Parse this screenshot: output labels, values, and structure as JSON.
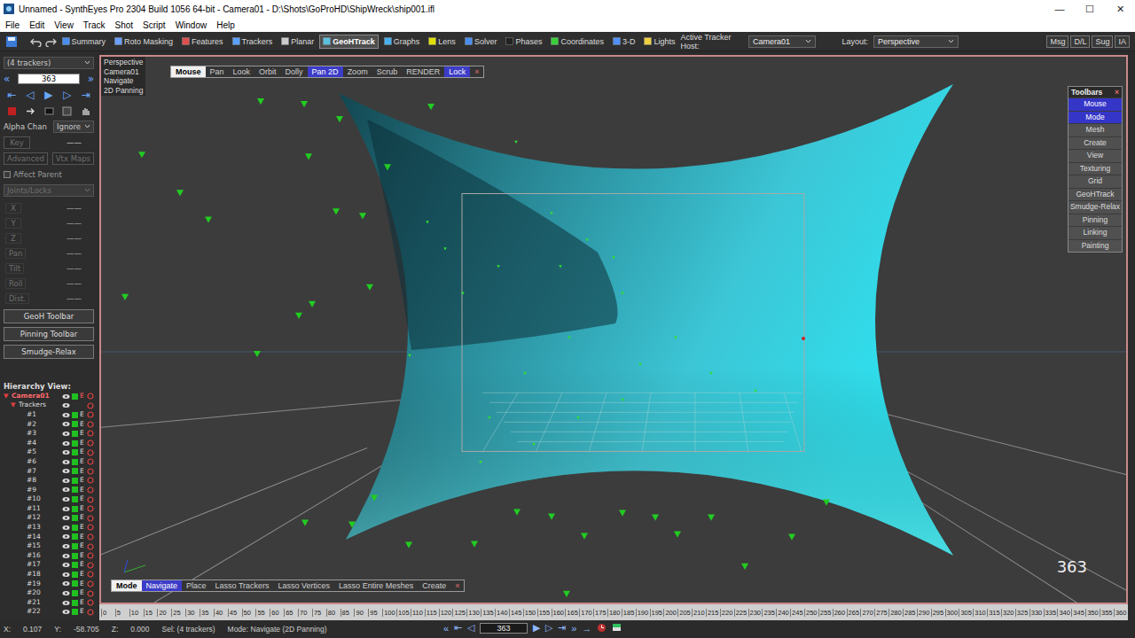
{
  "window": {
    "title": "Unnamed - SynthEyes Pro 2304 Build 1056 64-bit - Camera01 - D:\\Shots\\GoProHD\\ShipWreck\\ship001.ifl",
    "controls": [
      "—",
      "☐",
      "✕"
    ]
  },
  "menu": [
    "File",
    "Edit",
    "View",
    "Track",
    "Shot",
    "Script",
    "Window",
    "Help"
  ],
  "toolbar": {
    "tabs": [
      {
        "label": "Summary",
        "selected": false
      },
      {
        "label": "Roto Masking",
        "selected": false
      },
      {
        "label": "Features",
        "selected": false
      },
      {
        "label": "Trackers",
        "selected": false
      },
      {
        "label": "Planar",
        "selected": false
      },
      {
        "label": "GeoHTrack",
        "selected": true
      },
      {
        "label": "Graphs",
        "selected": false
      },
      {
        "label": "Lens",
        "selected": false
      },
      {
        "label": "Solver",
        "selected": false
      },
      {
        "label": "Phases",
        "selected": false
      },
      {
        "label": "Coordinates",
        "selected": false
      },
      {
        "label": "3-D",
        "selected": false
      },
      {
        "label": "Lights",
        "selected": false
      }
    ],
    "host_label": "Active Tracker Host:",
    "host_value": "Camera01",
    "layout_label": "Layout:",
    "layout_value": "Perspective",
    "buttons": [
      "Msg",
      "D/L",
      "Sug",
      "IA"
    ]
  },
  "left_panel": {
    "selection": "(4 trackers)",
    "nav": [
      "«",
      "»"
    ],
    "frame": "363",
    "transport": [
      "⇤",
      "◁",
      "▶",
      "▷",
      "⇥"
    ],
    "alpha_label": "Alpha Chan",
    "alpha_value": "Ignore",
    "key": {
      "label": "Key",
      "value": "——",
      "disabled": true
    },
    "advanced": {
      "label": "Advanced",
      "disabled": true
    },
    "vtx_maps": {
      "label": "Vtx Maps",
      "disabled": true
    },
    "affect_parent": {
      "label": "Affect Parent",
      "checked": false
    },
    "joints": {
      "label": "Joints/Locks",
      "disabled": true
    },
    "fields": [
      {
        "label": "X",
        "value": "——"
      },
      {
        "label": "Y",
        "value": "——"
      },
      {
        "label": "Z",
        "value": "——"
      },
      {
        "label": "Pan",
        "value": "——"
      },
      {
        "label": "Tilt",
        "value": "——"
      },
      {
        "label": "Roll",
        "value": "——"
      },
      {
        "label": "Dist.",
        "value": "——"
      }
    ],
    "buttons": [
      "GeoH Toolbar",
      "Pinning Toolbar",
      "Smudge-Relax"
    ]
  },
  "hierarchy": {
    "title": "Hierarchy View:",
    "rows": [
      {
        "label": "Camera01",
        "kind": "camera",
        "toggle": "▼",
        "flag": "E"
      },
      {
        "label": "Trackers",
        "kind": "group",
        "toggle": "▼",
        "flag": ""
      },
      {
        "label": "#1",
        "kind": "tracker",
        "toggle": "",
        "flag": "E"
      },
      {
        "label": "#2",
        "kind": "tracker",
        "toggle": "",
        "flag": "E"
      },
      {
        "label": "#3",
        "kind": "tracker",
        "toggle": "",
        "flag": "E"
      },
      {
        "label": "#4",
        "kind": "tracker",
        "toggle": "",
        "flag": "E"
      },
      {
        "label": "#5",
        "kind": "tracker",
        "toggle": "",
        "flag": "E"
      },
      {
        "label": "#6",
        "kind": "tracker",
        "toggle": "",
        "flag": "E"
      },
      {
        "label": "#7",
        "kind": "tracker",
        "toggle": "",
        "flag": "E"
      },
      {
        "label": "#8",
        "kind": "tracker",
        "toggle": "",
        "flag": "E"
      },
      {
        "label": "#9",
        "kind": "tracker",
        "toggle": "",
        "flag": "E"
      },
      {
        "label": "#10",
        "kind": "tracker",
        "toggle": "",
        "flag": "E"
      },
      {
        "label": "#11",
        "kind": "tracker",
        "toggle": "",
        "flag": "E"
      },
      {
        "label": "#12",
        "kind": "tracker",
        "toggle": "",
        "flag": "E"
      },
      {
        "label": "#13",
        "kind": "tracker",
        "toggle": "",
        "flag": "E"
      },
      {
        "label": "#14",
        "kind": "tracker",
        "toggle": "",
        "flag": "E"
      },
      {
        "label": "#15",
        "kind": "tracker",
        "toggle": "",
        "flag": "E"
      },
      {
        "label": "#16",
        "kind": "tracker",
        "toggle": "",
        "flag": "E"
      },
      {
        "label": "#17",
        "kind": "tracker",
        "toggle": "",
        "flag": "E"
      },
      {
        "label": "#18",
        "kind": "tracker",
        "toggle": "",
        "flag": "E"
      },
      {
        "label": "#19",
        "kind": "tracker",
        "toggle": "",
        "flag": "E"
      },
      {
        "label": "#20",
        "kind": "tracker",
        "toggle": "",
        "flag": "E"
      },
      {
        "label": "#21",
        "kind": "tracker",
        "toggle": "",
        "flag": "E"
      },
      {
        "label": "#22",
        "kind": "tracker",
        "toggle": "",
        "flag": "E"
      }
    ]
  },
  "viewport": {
    "info": [
      "Perspective",
      "Camera01",
      "Navigate",
      "2D Panning"
    ],
    "mouse_header": "Mouse",
    "mouse_modes": [
      {
        "label": "Pan",
        "selected": false
      },
      {
        "label": "Look",
        "selected": false
      },
      {
        "label": "Orbit",
        "selected": false
      },
      {
        "label": "Dolly",
        "selected": false
      },
      {
        "label": "Pan 2D",
        "selected": true
      },
      {
        "label": "Zoom",
        "selected": false
      },
      {
        "label": "Scrub",
        "selected": false
      },
      {
        "label": "RENDER",
        "selected": false
      },
      {
        "label": "Lock",
        "selected": true
      }
    ],
    "mouse_close": "×",
    "mode_header": "Mode",
    "modes": [
      {
        "label": "Navigate",
        "selected": true
      },
      {
        "label": "Place",
        "selected": false
      },
      {
        "label": "Lasso Trackers",
        "selected": false
      },
      {
        "label": "Lasso Vertices",
        "selected": false
      },
      {
        "label": "Lasso Entire Meshes",
        "selected": false
      },
      {
        "label": "Create",
        "selected": false
      }
    ],
    "modes_close": "×",
    "frame": "363"
  },
  "toolbars_panel": {
    "title": "Toolbars",
    "close": "×",
    "items": [
      {
        "label": "Mouse",
        "selected": true
      },
      {
        "label": "Mode",
        "selected": true
      },
      {
        "label": "Mesh",
        "selected": false
      },
      {
        "label": "Create",
        "selected": false
      },
      {
        "label": "View",
        "selected": false
      },
      {
        "label": "Texturing",
        "selected": false
      },
      {
        "label": "Grid",
        "selected": false
      },
      {
        "label": "GeoHTrack",
        "selected": false
      },
      {
        "label": "Smudge-Relax",
        "selected": false
      },
      {
        "label": "Pinning",
        "selected": false
      },
      {
        "label": "Linking",
        "selected": false
      },
      {
        "label": "Painting",
        "selected": false
      }
    ]
  },
  "timeline": {
    "ticks": [
      "0",
      "5",
      "10",
      "15",
      "20",
      "25",
      "30",
      "35",
      "40",
      "45",
      "50",
      "55",
      "60",
      "65",
      "70",
      "75",
      "80",
      "85",
      "90",
      "95",
      "100",
      "105",
      "110",
      "115",
      "120",
      "125",
      "130",
      "135",
      "140",
      "145",
      "150",
      "155",
      "160",
      "165",
      "170",
      "175",
      "180",
      "185",
      "190",
      "195",
      "200",
      "205",
      "210",
      "215",
      "220",
      "225",
      "230",
      "235",
      "240",
      "245",
      "250",
      "255",
      "260",
      "265",
      "270",
      "275",
      "280",
      "285",
      "290",
      "295",
      "300",
      "305",
      "310",
      "315",
      "320",
      "325",
      "330",
      "335",
      "340",
      "345",
      "350",
      "355",
      "360"
    ]
  },
  "status_bar": {
    "x": "X:",
    "x_value": "0.107",
    "y": "Y:",
    "y_value": "-58.705",
    "z": "Z:",
    "z_value": "0.000",
    "selection": "Sel: (4 trackers)",
    "mode": "Mode: Navigate (2D Panning)",
    "transport": [
      "«",
      "⇤",
      "◁",
      "▶",
      "▷",
      "⇥",
      "»",
      "→"
    ],
    "frame": "363"
  }
}
